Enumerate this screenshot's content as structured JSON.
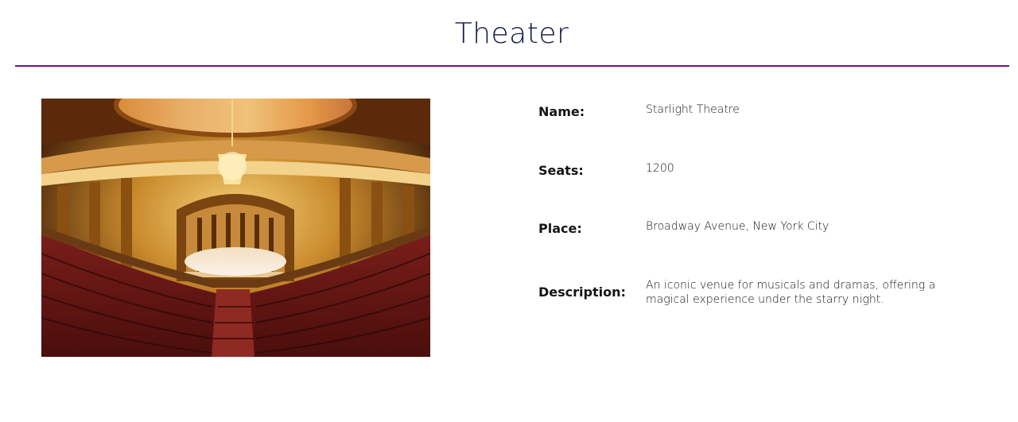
{
  "page": {
    "title": "Theater",
    "accent_color": "#7a0f8c",
    "title_color": "#141a45"
  },
  "image": {
    "alt": "",
    "subject": "theater-auditorium-photo"
  },
  "details": [
    {
      "label": "Name:",
      "value": "Starlight Theatre"
    },
    {
      "label": "Seats:",
      "value": "1200"
    },
    {
      "label": "Place:",
      "value": "Broadway Avenue, New York City"
    },
    {
      "label": "Description:",
      "value": "An iconic venue for musicals and dramas, offering a magical experience under the starry night."
    }
  ]
}
